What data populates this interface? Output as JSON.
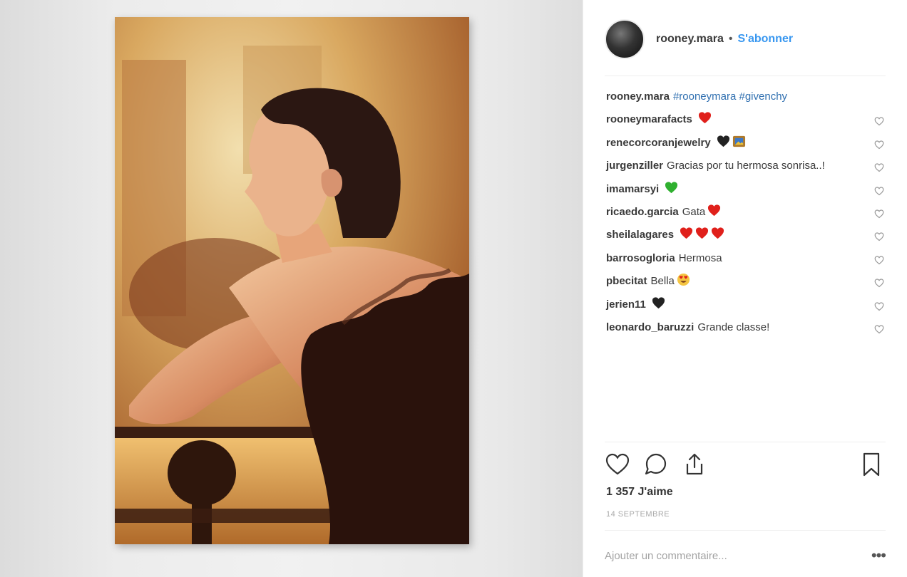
{
  "post": {
    "username": "rooney.mara",
    "separator": "•",
    "follow_label": "S'abonner",
    "caption_user": "rooney.mara",
    "caption_tags": "#rooneymara #givenchy",
    "likes": "1 357 J'aime",
    "date": "14 SEPTEMBRE",
    "add_comment_placeholder": "Ajouter un commentaire...",
    "more_label": "•••"
  },
  "comments": [
    {
      "user": "rooneymarafacts",
      "text": "",
      "emoji": [
        "red-heart"
      ]
    },
    {
      "user": "renecorcoranjewelry",
      "text": "",
      "emoji": [
        "black-heart",
        "framed-picture"
      ]
    },
    {
      "user": "jurgenziller",
      "text": "Gracias por tu hermosa sonrisa..!",
      "emoji": []
    },
    {
      "user": "imamarsyi",
      "text": "",
      "emoji": [
        "green-heart"
      ]
    },
    {
      "user": "ricaedo.garcia",
      "text": "Gata",
      "emoji": [
        "red-heart"
      ]
    },
    {
      "user": "sheilalagares",
      "text": "",
      "emoji": [
        "red-heart",
        "red-heart",
        "red-heart"
      ]
    },
    {
      "user": "barrosogloria",
      "text": "Hermosa",
      "emoji": []
    },
    {
      "user": "pbecitat",
      "text": "Bella",
      "emoji": [
        "heart-eyes"
      ]
    },
    {
      "user": "jerien11",
      "text": "",
      "emoji": [
        "black-heart"
      ]
    },
    {
      "user": "leonardo_baruzzi",
      "text": "Grande classe!",
      "emoji": []
    }
  ],
  "colors": {
    "link_blue": "#3897f0",
    "tag_blue": "#2f6fb0",
    "red_heart": "#e0201b",
    "green_heart": "#2fb02f",
    "black_heart": "#222222"
  },
  "icons": [
    "heart-icon",
    "comment-icon",
    "share-icon",
    "bookmark-icon",
    "more-icon"
  ]
}
